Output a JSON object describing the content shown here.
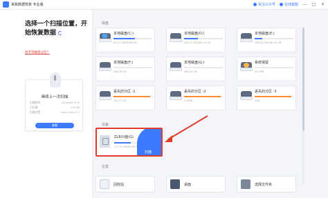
{
  "app": {
    "title": "易我数据恢复 专业版",
    "follow_label": "关注公众号",
    "online_service_label": "在线客服",
    "minimize": "—",
    "maximize": "□",
    "close": "✕"
  },
  "left_panel": {
    "title": "选择一个扫描位置，开始恢复数据",
    "help_link": "找不到磁盘分区？",
    "last_scan": {
      "title": "继续上一次扫描",
      "rows": [
        {
          "label": "扫描时间",
          "value": "2024/4/6 9:02"
        },
        {
          "label": "已扫描",
          "value": "2.0 GB"
        },
        {
          "label": "扫描位置",
          "value": "Local Disk (C:)"
        }
      ],
      "button_label": "查看"
    }
  },
  "sections": {
    "disk": "磁盘",
    "device": "设备",
    "location": "位置"
  },
  "drives": [
    {
      "name": "本地磁盘(C:)",
      "size": "89.07 GB/98.86 GB",
      "fill": 0.55,
      "kind": "win",
      "bar": "blue"
    },
    {
      "name": "本地磁盘(D:)",
      "size": "484.02 GB/488.28 GB",
      "fill": 0.35,
      "kind": "plain",
      "bar": "blue"
    },
    {
      "name": "本地磁盘(E:)",
      "size": "398.02 GB/488.28 GB",
      "fill": 0.2,
      "kind": "plain",
      "bar": "blue"
    },
    {
      "name": "本地磁盘(F:)",
      "size": "488.28 GB",
      "fill": 0.0,
      "kind": "plain",
      "bar": "blue"
    },
    {
      "name": "本地磁盘(G:)",
      "size": "488.28 GB",
      "fill": 0.0,
      "kind": "plain",
      "bar": "blue"
    },
    {
      "name": "系统保留",
      "size": "500 MB",
      "fill": 0.0,
      "kind": "warn",
      "bar": "orange"
    },
    {
      "name": "丢失的分区 -1",
      "size": "125.77 GB",
      "fill": 0.95,
      "kind": "plain",
      "bar": "orange"
    },
    {
      "name": "丢失的分区 -2",
      "size": "118MB",
      "fill": 0.95,
      "kind": "plain",
      "bar": "orange"
    },
    {
      "name": "丢失的分区 -3",
      "size": "1GB",
      "fill": 0.95,
      "kind": "plain",
      "bar": "orange"
    }
  ],
  "device": {
    "name": "ZLB(U盘(G)",
    "size": "377.61 MB/B/738.3",
    "scan_label": "扫描"
  },
  "locations": [
    {
      "name": "回收站",
      "icon": "recycle-bin-icon"
    },
    {
      "name": "桌面",
      "icon": "desktop-icon"
    },
    {
      "name": "选择文件夹",
      "icon": "folder-icon"
    }
  ],
  "colors": {
    "accent": "#3a7bff",
    "warning": "#ff8a2b",
    "highlight": "#e23b2e"
  }
}
